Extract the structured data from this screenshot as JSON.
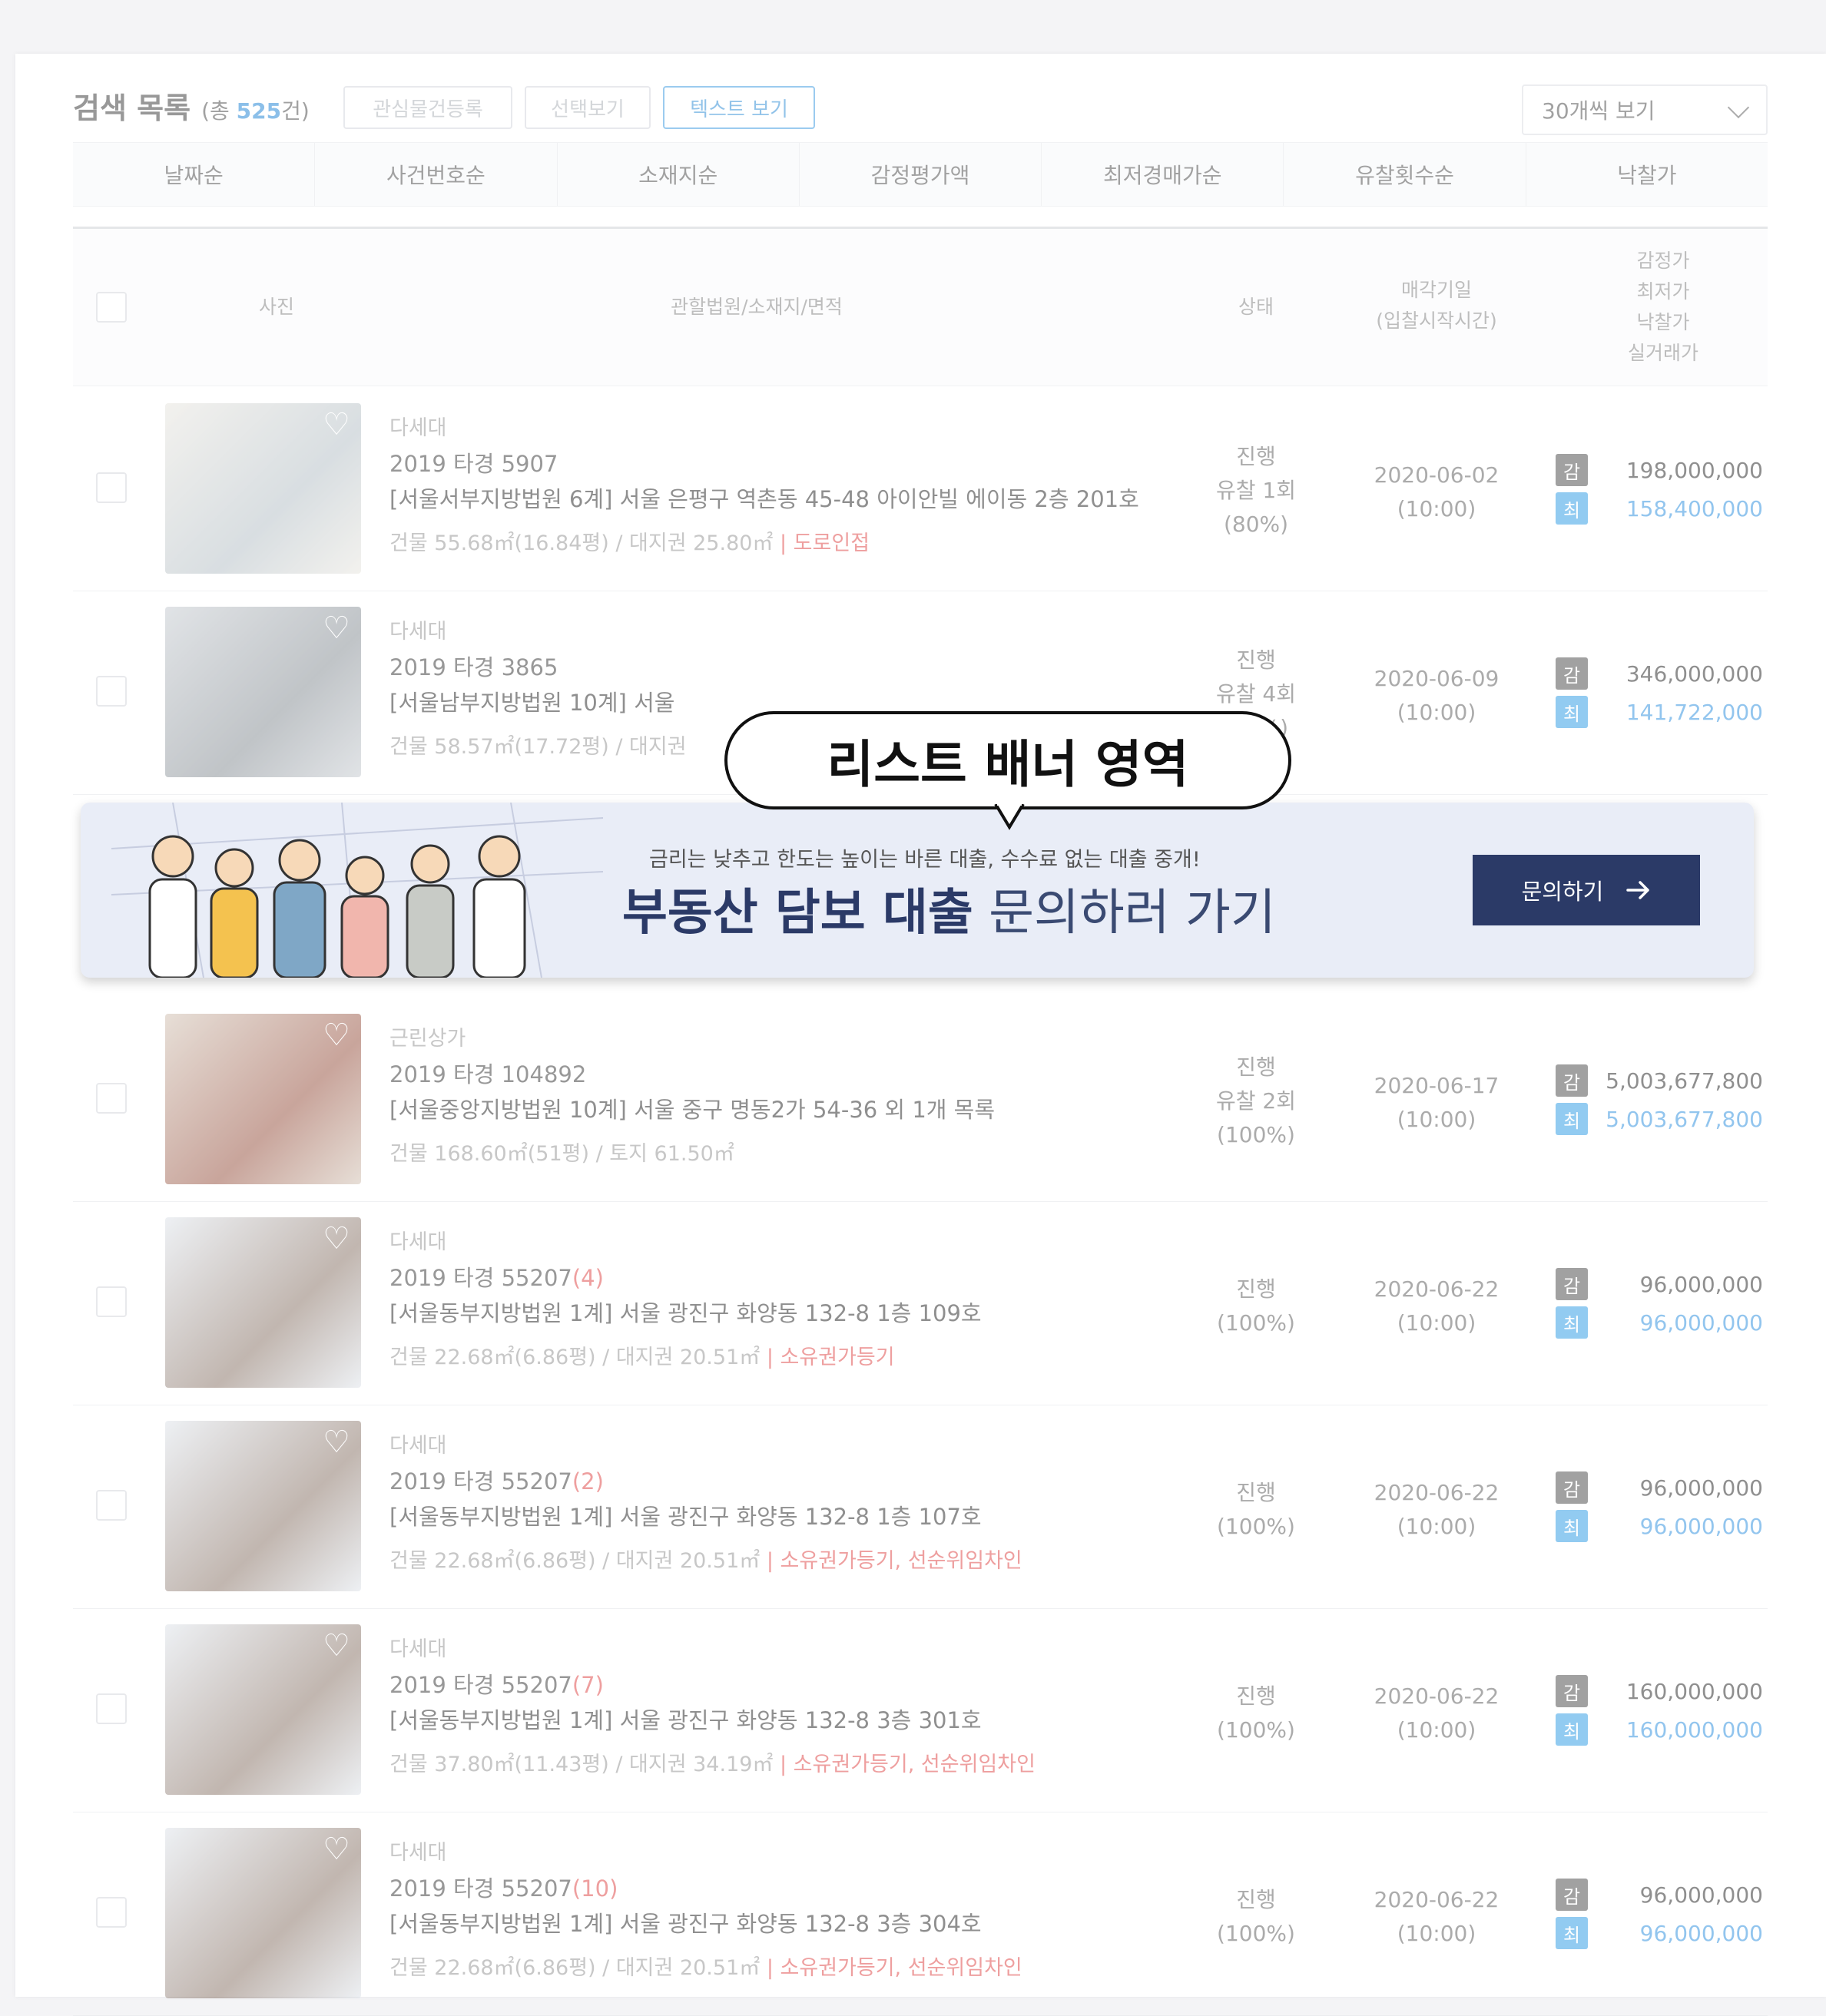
{
  "header": {
    "title": "검색 목록",
    "count_prefix": "(총 ",
    "count_value": "525",
    "count_suffix": "건)",
    "buttons": [
      "관심물건등록",
      "선택보기",
      "텍스트 보기"
    ],
    "page_size_select": "30개씩 보기"
  },
  "sort_tabs": [
    "날짜순",
    "사건번호순",
    "소재지순",
    "감정평가액",
    "최저경매가순",
    "유찰횟수순",
    "낙찰가"
  ],
  "table_header": {
    "photo": "사진",
    "court_addr_area": "관할법원/소재지/면적",
    "status": "상태",
    "sale_date_line1": "매각기일",
    "sale_date_line2": "(입찰시작시간)",
    "price_line1": "감정가",
    "price_line2": "최저가",
    "price_line3": "낙찰가",
    "price_line4": "실거래가"
  },
  "rows": [
    {
      "kind": "다세대",
      "case": "2019 타경 5907",
      "case_suffix": "",
      "addr": "[서울서부지방법원 6계] 서울 은평구 역촌동 45-48 아이안빌 에이동 2층 201호",
      "area": "건물 55.68㎡(16.84평) / 대지권 25.80㎡",
      "area_tag": "  |  도로인접",
      "status1": "진행",
      "status2": "유찰 1회",
      "status3": "(80%)",
      "date": "2020-06-02",
      "time": "(10:00)",
      "tag_gam": "감",
      "tag_choi": "최",
      "appraisal": "198,000,000",
      "minimum": "158,400,000"
    },
    {
      "kind": "다세대",
      "case": "2019 타경 3865",
      "case_suffix": "",
      "addr": "[서울남부지방법원 10계] 서울",
      "area": "건물 58.57㎡(17.72평) / 대지권",
      "area_tag": "",
      "status1": "진행",
      "status2": "유찰 4회",
      "status3": "(41%)",
      "date": "2020-06-09",
      "time": "(10:00)",
      "tag_gam": "감",
      "tag_choi": "최",
      "appraisal": "346,000,000",
      "minimum": "141,722,000"
    },
    {
      "kind": "근린상가",
      "case": "2019 타경 104892",
      "case_suffix": "",
      "addr": "[서울중앙지방법원 10계] 서울 중구 명동2가 54-36 외 1개 목록",
      "area": "건물 168.60㎡(51평) / 토지 61.50㎡",
      "area_tag": "",
      "status1": "진행",
      "status2": "유찰 2회",
      "status3": "(100%)",
      "date": "2020-06-17",
      "time": "(10:00)",
      "tag_gam": "감",
      "tag_choi": "최",
      "appraisal": "5,003,677,800",
      "minimum": "5,003,677,800"
    },
    {
      "kind": "다세대",
      "case": "2019 타경 55207",
      "case_suffix": "(4)",
      "addr": "[서울동부지방법원 1계] 서울 광진구 화양동 132-8 1층 109호",
      "area": "건물 22.68㎡(6.86평) / 대지권 20.51㎡",
      "area_tag": "  |  소유권가등기",
      "status1": "진행",
      "status2": "(100%)",
      "status3": "",
      "date": "2020-06-22",
      "time": "(10:00)",
      "tag_gam": "감",
      "tag_choi": "최",
      "appraisal": "96,000,000",
      "minimum": "96,000,000"
    },
    {
      "kind": "다세대",
      "case": "2019 타경 55207",
      "case_suffix": "(2)",
      "addr": "[서울동부지방법원 1계] 서울 광진구 화양동 132-8 1층 107호",
      "area": "건물 22.68㎡(6.86평) / 대지권 20.51㎡",
      "area_tag": "  |  소유권가등기, 선순위임차인",
      "status1": "진행",
      "status2": "(100%)",
      "status3": "",
      "date": "2020-06-22",
      "time": "(10:00)",
      "tag_gam": "감",
      "tag_choi": "최",
      "appraisal": "96,000,000",
      "minimum": "96,000,000"
    },
    {
      "kind": "다세대",
      "case": "2019 타경 55207",
      "case_suffix": "(7)",
      "addr": "[서울동부지방법원 1계] 서울 광진구 화양동 132-8 3층 301호",
      "area": "건물 37.80㎡(11.43평) / 대지권 34.19㎡",
      "area_tag": "  |  소유권가등기, 선순위임차인",
      "status1": "진행",
      "status2": "(100%)",
      "status3": "",
      "date": "2020-06-22",
      "time": "(10:00)",
      "tag_gam": "감",
      "tag_choi": "최",
      "appraisal": "160,000,000",
      "minimum": "160,000,000"
    },
    {
      "kind": "다세대",
      "case": "2019 타경 55207",
      "case_suffix": "(10)",
      "addr": "[서울동부지방법원 1계] 서울 광진구 화양동 132-8 3층 304호",
      "area": "건물 22.68㎡(6.86평) / 대지권 20.51㎡",
      "area_tag": "  |  소유권가등기, 선순위임차인",
      "status1": "진행",
      "status2": "(100%)",
      "status3": "",
      "date": "2020-06-22",
      "time": "(10:00)",
      "tag_gam": "감",
      "tag_choi": "최",
      "appraisal": "96,000,000",
      "minimum": "96,000,000"
    }
  ],
  "banner": {
    "sub": "금리는 낮추고 한도는 높이는 바른 대출, 수수료 없는 대출 중개!",
    "main_bold": "부동산 담보 대출",
    "main_light": " 문의하러 가기",
    "button": "문의하기",
    "button_icon": "arrow-right-icon"
  },
  "callout": {
    "text": "리스트 배너 영역"
  },
  "colors": {
    "accent_blue": "#3a96e0",
    "banner_navy": "#2b3a67",
    "warn_red": "#e05050",
    "banner_bg": "#e9edf7"
  }
}
